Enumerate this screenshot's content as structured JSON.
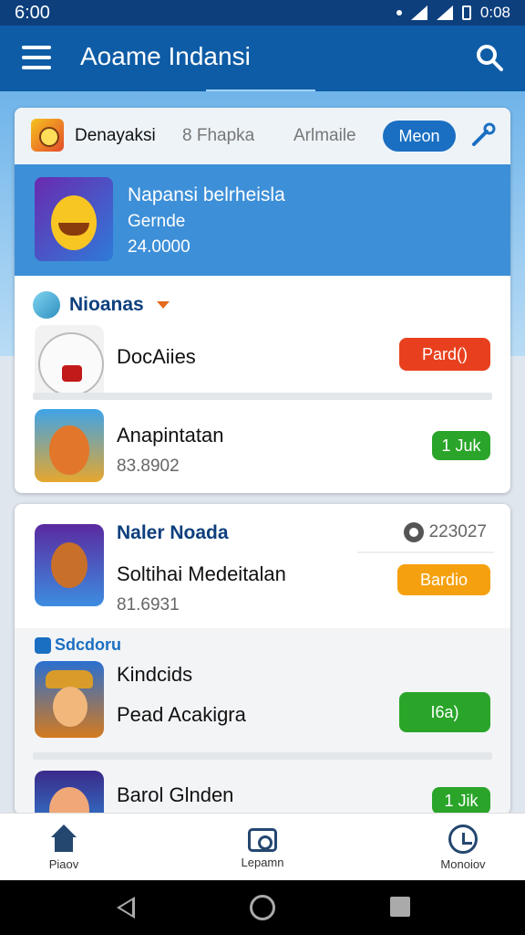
{
  "status": {
    "time": "6:00",
    "clock_right": "0:08"
  },
  "appbar": {
    "title": "Aoame Indansi"
  },
  "tabs": {
    "logo_icon": "game-logo-icon",
    "active": "Denayaksi",
    "tab2": "8 Fhapka",
    "tab3": "Arlmaile",
    "pill": "Meon"
  },
  "banner": {
    "title": "Napansi belrheisla",
    "subtitle": "Gernde",
    "number": "24.0000"
  },
  "section1": {
    "title": "Nioanas"
  },
  "rows1": [
    {
      "title": "DocAiies",
      "button": "Pard()",
      "button_color": "#e8401e"
    },
    {
      "title": "Anapintatan",
      "sub": "83.8902",
      "button": "1 Juk",
      "button_color": "#2aa52a"
    }
  ],
  "card2": {
    "head": "Naler Noada",
    "count": "223027",
    "row_title": "Soltihai Medeitalan",
    "row_sub": "81.6931",
    "row_button": "Bardio",
    "row_button_color": "#f5a10f",
    "section_label": "Sdcdoru",
    "rows": [
      {
        "line1": "Kindcids",
        "line2": "Pead Acakigra",
        "button": "I6a)",
        "button_color": "#2aa52a"
      },
      {
        "line1": "Barol Glnden",
        "button": "1 Jik",
        "button_color": "#2aa52a"
      }
    ]
  },
  "bottomnav": {
    "item1": "Piaov",
    "item2": "Lepamn",
    "item3": "Monoiov"
  }
}
